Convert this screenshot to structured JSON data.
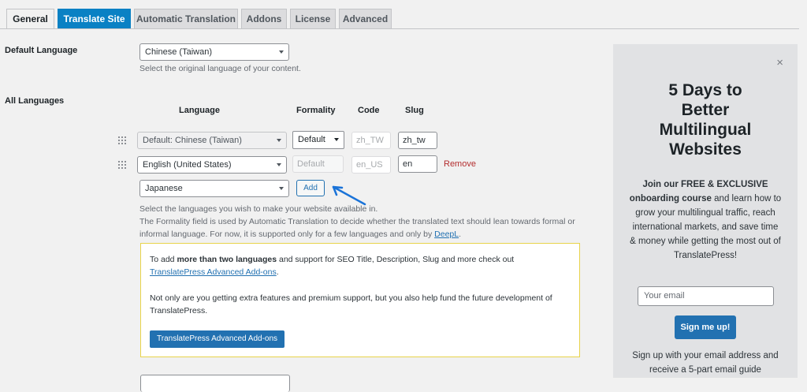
{
  "tabs": [
    "General",
    "Translate Site",
    "Automatic Translation",
    "Addons",
    "License",
    "Advanced"
  ],
  "default_language": {
    "label": "Default Language",
    "value": "Chinese (Taiwan)",
    "description": "Select the original language of your content."
  },
  "all_languages": {
    "label": "All Languages",
    "headers": {
      "language": "Language",
      "formality": "Formality",
      "code": "Code",
      "slug": "Slug"
    },
    "rows": [
      {
        "language": "Default: Chinese (Taiwan)",
        "formality": "Default",
        "code": "zh_TW",
        "slug": "zh_tw"
      },
      {
        "language": "English (United States)",
        "formality": "Default",
        "code": "en_US",
        "slug": "en",
        "remove": "Remove"
      }
    ],
    "new_language": "Japanese",
    "add_label": "Add",
    "description_1": "Select the languages you wish to make your website available in.",
    "description_2": "The Formality field is used by Automatic Translation to decide whether the translated text should lean towards formal or informal language. For now, it is supported only for a few languages and only by",
    "deepl_link": "DeepL",
    "description_end": "."
  },
  "notice": {
    "p1_prefix": "To add ",
    "p1_bold": "more than two languages",
    "p1_suffix": " and support for SEO Title, Description, Slug and more check out",
    "p1_link": "TranslatePress Advanced Add-ons",
    "p1_end": ".",
    "p2": "Not only are you getting extra features and premium support, but you also help fund the future development of TranslatePress.",
    "button": "TranslatePress Advanced Add-ons"
  },
  "sidebar": {
    "close": "×",
    "title_lines": [
      "5 Days to",
      "Better",
      "Multilingual",
      "Websites"
    ],
    "body_bold": "Join our FREE & EXCLUSIVE onboarding course",
    "body_rest": " and learn how to grow your multilingual traffic, reach international markets, and save time & money while getting the most out of TranslatePress!",
    "email_placeholder": "Your email",
    "signup_button": "Sign me up!",
    "footer": "Sign up with your email address and receive a 5-part email guide"
  },
  "colors": {
    "tab_promo": "#0a81c4",
    "primary": "#2271b1",
    "remove": "#b32d2e",
    "arrow": "#1a73d8",
    "notice_border": "#e8d34a"
  }
}
